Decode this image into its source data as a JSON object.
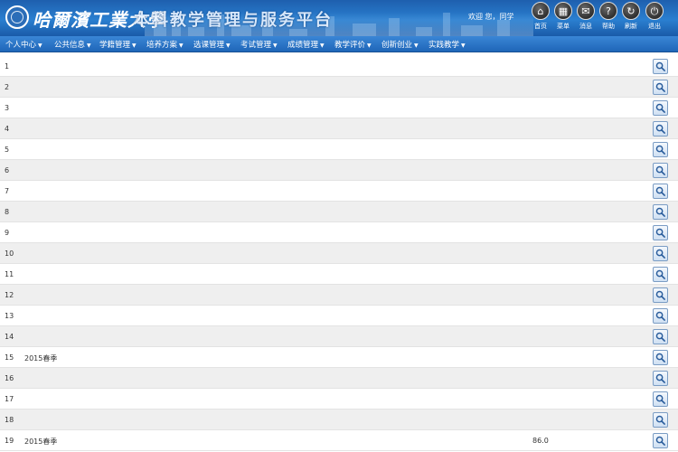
{
  "header": {
    "school_name": "哈爾濱工業大學",
    "platform_name": "本科教学管理与服务平台",
    "welcome": "欢迎  您，同学",
    "tools": [
      {
        "label": "首页",
        "icon": "home-icon",
        "glyph": "⌂"
      },
      {
        "label": "菜单",
        "icon": "grid-icon",
        "glyph": "▦"
      },
      {
        "label": "消息",
        "icon": "message-icon",
        "glyph": "✉"
      },
      {
        "label": "帮助",
        "icon": "help-icon",
        "glyph": "?"
      },
      {
        "label": "刷新",
        "icon": "refresh-icon",
        "glyph": "↻"
      },
      {
        "label": "退出",
        "icon": "power-icon",
        "glyph": "⏻"
      }
    ]
  },
  "nav": [
    "个人中心",
    "公共信息",
    "学籍管理",
    "培养方案",
    "选课管理",
    "考试管理",
    "成绩管理",
    "教学评价",
    "创新创业",
    "实践教学"
  ],
  "rows": [
    {
      "idx": "1",
      "term": "",
      "course": "",
      "code": "",
      "class": "",
      "type": "",
      "teacher": "",
      "hours": "",
      "w1": "",
      "w2": "",
      "score": "",
      "note": ""
    },
    {
      "idx": "2",
      "term": "",
      "course": "",
      "code": "",
      "class": "",
      "type": "",
      "teacher": "",
      "hours": "",
      "w1": "",
      "w2": "",
      "score": "",
      "note": ""
    },
    {
      "idx": "3",
      "term": "",
      "course": "",
      "code": "",
      "class": "",
      "type": "",
      "teacher": "",
      "hours": "",
      "w1": "",
      "w2": "",
      "score": "",
      "note": ""
    },
    {
      "idx": "4",
      "term": "",
      "course": "",
      "code": "",
      "class": "",
      "type": "",
      "teacher": "",
      "hours": "",
      "w1": "",
      "w2": "",
      "score": "",
      "note": ""
    },
    {
      "idx": "5",
      "term": "",
      "course": "",
      "code": "",
      "class": "",
      "type": "",
      "teacher": "",
      "hours": "",
      "w1": "",
      "w2": "",
      "score": "",
      "note": ""
    },
    {
      "idx": "6",
      "term": "",
      "course": "",
      "code": "",
      "class": "",
      "type": "",
      "teacher": "",
      "hours": "",
      "w1": "",
      "w2": "",
      "score": "",
      "note": ""
    },
    {
      "idx": "7",
      "term": "",
      "course": "",
      "code": "",
      "class": "",
      "type": "",
      "teacher": "",
      "hours": "",
      "w1": "",
      "w2": "",
      "score": "",
      "note": ""
    },
    {
      "idx": "8",
      "term": "",
      "course": "",
      "code": "",
      "class": "",
      "type": "",
      "teacher": "",
      "hours": "",
      "w1": "",
      "w2": "",
      "score": "",
      "note": ""
    },
    {
      "idx": "9",
      "term": "",
      "course": "",
      "code": "",
      "class": "",
      "type": "",
      "teacher": "",
      "hours": "",
      "w1": "",
      "w2": "",
      "score": "",
      "note": ""
    },
    {
      "idx": "10",
      "term": "",
      "course": "",
      "code": "",
      "class": "",
      "type": "",
      "teacher": "",
      "hours": "",
      "w1": "",
      "w2": "",
      "score": "",
      "note": ""
    },
    {
      "idx": "11",
      "term": "",
      "course": "",
      "code": "",
      "class": "",
      "type": "",
      "teacher": "",
      "hours": "",
      "w1": "",
      "w2": "",
      "score": "",
      "note": ""
    },
    {
      "idx": "12",
      "term": "",
      "course": "",
      "code": "",
      "class": "",
      "type": "",
      "teacher": "",
      "hours": "",
      "w1": "",
      "w2": "",
      "score": "",
      "note": ""
    },
    {
      "idx": "13",
      "term": "",
      "course": "",
      "code": "",
      "class": "",
      "type": "",
      "teacher": "",
      "hours": "",
      "w1": "",
      "w2": "",
      "score": "",
      "note": ""
    },
    {
      "idx": "14",
      "term": "",
      "course": "",
      "code": "",
      "class": "",
      "type": "",
      "teacher": "",
      "hours": "",
      "w1": "",
      "w2": "",
      "score": "",
      "note": ""
    },
    {
      "idx": "15",
      "term": "2015春季",
      "course": "",
      "code": "",
      "class": "",
      "type": "",
      "teacher": "",
      "hours": "",
      "w1": "",
      "w2": "",
      "score": "",
      "note": ""
    },
    {
      "idx": "16",
      "term": "",
      "course": "",
      "code": "",
      "class": "",
      "type": "",
      "teacher": "",
      "hours": "",
      "w1": "",
      "w2": "",
      "score": "",
      "note": ""
    },
    {
      "idx": "17",
      "term": "",
      "course": "",
      "code": "",
      "class": "",
      "type": "",
      "teacher": "",
      "hours": "",
      "w1": "",
      "w2": "",
      "score": "",
      "note": ""
    },
    {
      "idx": "18",
      "term": "",
      "course": "",
      "code": "",
      "class": "",
      "type": "",
      "teacher": "",
      "hours": "",
      "w1": "",
      "w2": "",
      "score": "",
      "note": ""
    },
    {
      "idx": "19",
      "term": "2015春季",
      "course": "",
      "code": "",
      "class": "",
      "type": "",
      "teacher": "",
      "hours": "",
      "w1": "",
      "w2": "",
      "score": "86.0",
      "note": ""
    }
  ]
}
